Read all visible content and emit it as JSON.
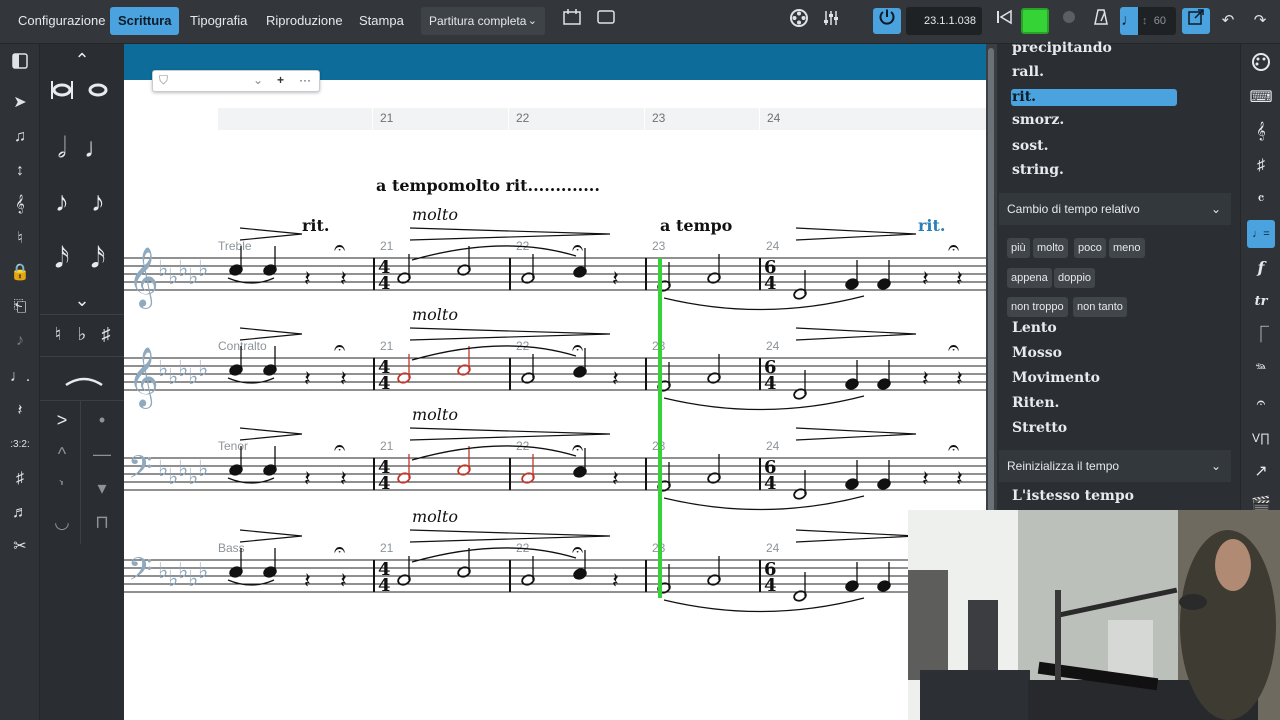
{
  "topbar": {
    "modes": [
      "Configurazione",
      "Scrittura",
      "Tipografia",
      "Riproduzione",
      "Stampa"
    ],
    "active_mode": "Scrittura",
    "layout_select": "Partitura completa",
    "counter": "23.1.1.038",
    "tempo_value": "60"
  },
  "left_panel": {
    "tuplet_label": ":3:2:"
  },
  "score": {
    "ruler_bars": [
      "21",
      "22",
      "23",
      "24"
    ],
    "system_text_top": "a tempomolto rit.............",
    "system_text_a_tempo": "a tempo",
    "rit_text": "rit.",
    "rit_text_blue": "rit.",
    "molto_text": "molto",
    "staves": [
      {
        "name": "Treble",
        "clef": "treble"
      },
      {
        "name": "Contralto",
        "clef": "treble"
      },
      {
        "name": "Tenor",
        "clef": "bass"
      },
      {
        "name": "Bass",
        "clef": "bass"
      }
    ],
    "bar_numbers": [
      "21",
      "22",
      "23",
      "24"
    ],
    "time_sig_a": [
      "4",
      "4"
    ],
    "time_sig_b": [
      "6",
      "4"
    ]
  },
  "right_panel": {
    "top_items": [
      "precipitando",
      "rall.",
      "rit.",
      "smorz.",
      "sost.",
      "string."
    ],
    "selected_item": "rit.",
    "section_relative": "Cambio di tempo relativo",
    "chips": [
      "più",
      "molto",
      "poco",
      "meno",
      "appena",
      "doppio",
      "non troppo",
      "non tanto"
    ],
    "relative_items": [
      "Lento",
      "Mosso",
      "Movimento",
      "Riten.",
      "Stretto"
    ],
    "section_reset": "Reinizializza il tempo",
    "reset_items": [
      "L'istesso tempo"
    ]
  },
  "colors": {
    "accent": "#4aa3df",
    "playhead": "#35d335",
    "score_header": "#0d6c9a",
    "selected_note": "#c0392b",
    "staff_label": "#8fa9bf"
  },
  "icons": {
    "palette": "palette-icon",
    "keyboard": "keyboard-icon",
    "clef": "treble-clef-icon",
    "sharp": "key-signature-icon",
    "tempo": "tempo-icon",
    "dynamics": "dynamics-icon",
    "trill": "trill-icon"
  }
}
